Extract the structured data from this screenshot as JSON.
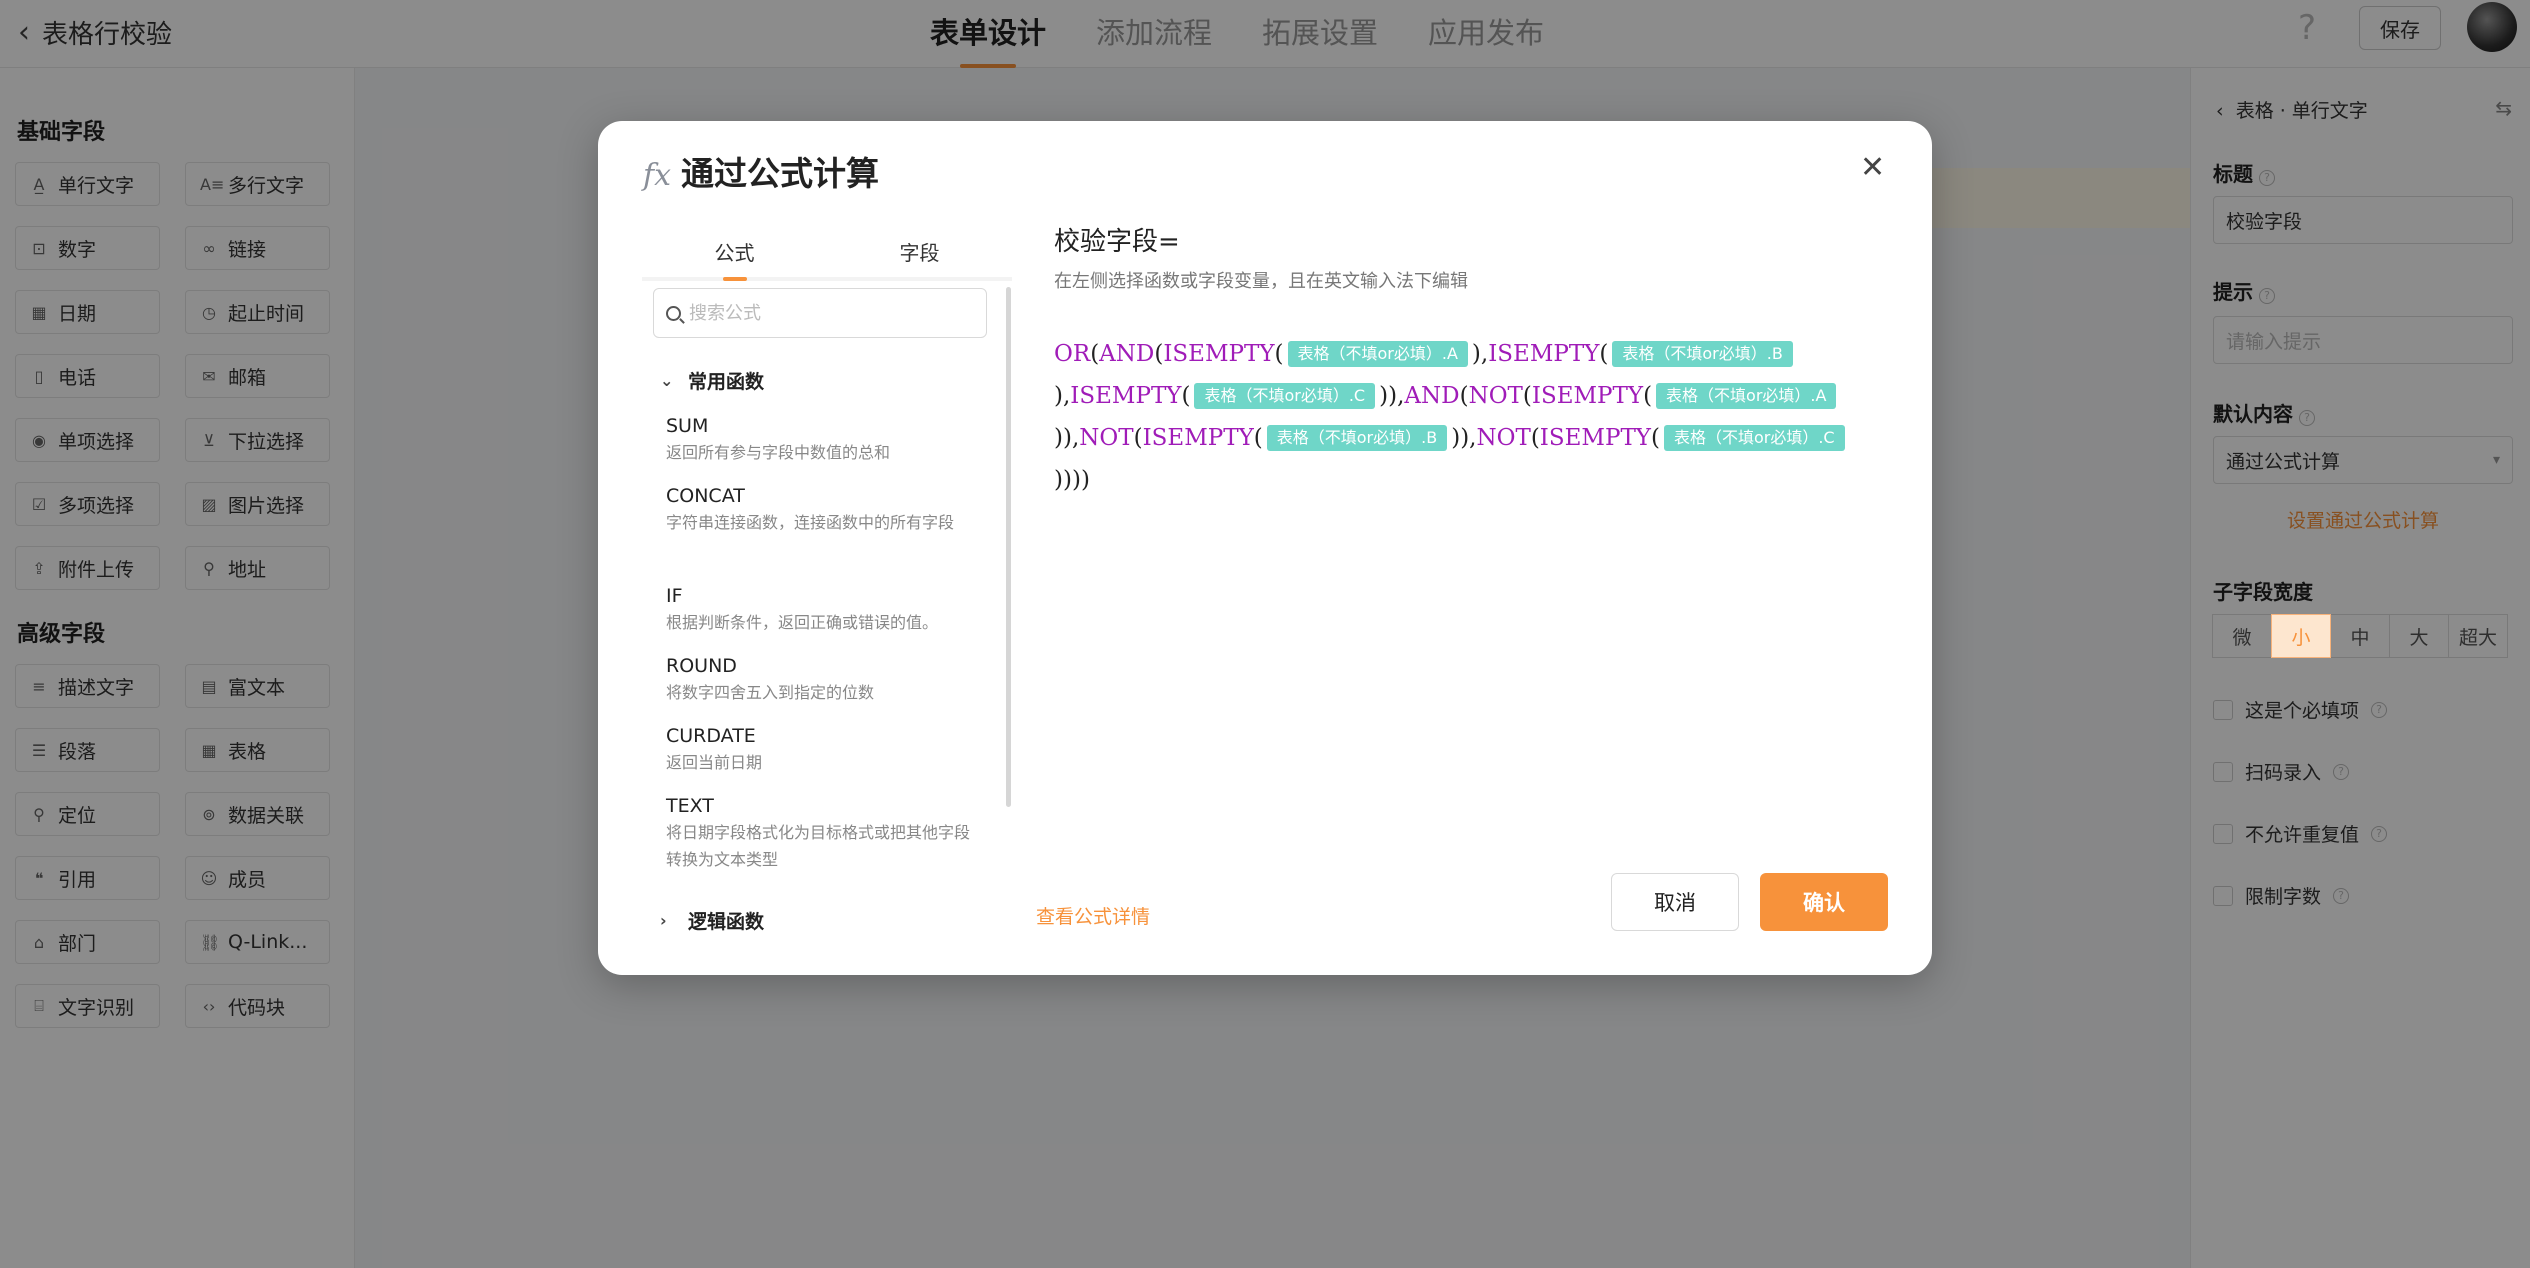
{
  "header": {
    "back_label": "表格行校验",
    "tabs": [
      {
        "label": "表单设计",
        "active": true
      },
      {
        "label": "添加流程",
        "active": false
      },
      {
        "label": "拓展设置",
        "active": false
      },
      {
        "label": "应用发布",
        "active": false
      }
    ],
    "help_glyph": "?",
    "save_label": "保存"
  },
  "left_panel": {
    "basic_title": "基础字段",
    "basic_fields": [
      {
        "label": "单行文字",
        "icon": "A̲"
      },
      {
        "label": "多行文字",
        "icon": "A≡"
      },
      {
        "label": "数字",
        "icon": "⊡"
      },
      {
        "label": "链接",
        "icon": "∞"
      },
      {
        "label": "日期",
        "icon": "▦"
      },
      {
        "label": "起止时间",
        "icon": "◷"
      },
      {
        "label": "电话",
        "icon": "▯"
      },
      {
        "label": "邮箱",
        "icon": "✉"
      },
      {
        "label": "单项选择",
        "icon": "◉"
      },
      {
        "label": "下拉选择",
        "icon": "⊻"
      },
      {
        "label": "多项选择",
        "icon": "☑"
      },
      {
        "label": "图片选择",
        "icon": "▨"
      },
      {
        "label": "附件上传",
        "icon": "⇪"
      },
      {
        "label": "地址",
        "icon": "⚲"
      }
    ],
    "advanced_title": "高级字段",
    "advanced_fields": [
      {
        "label": "描述文字",
        "icon": "≡"
      },
      {
        "label": "富文本",
        "icon": "▤"
      },
      {
        "label": "段落",
        "icon": "☰"
      },
      {
        "label": "表格",
        "icon": "▦"
      },
      {
        "label": "定位",
        "icon": "⚲"
      },
      {
        "label": "数据关联",
        "icon": "⊚"
      },
      {
        "label": "引用",
        "icon": "❝"
      },
      {
        "label": "成员",
        "icon": "☺"
      },
      {
        "label": "部门",
        "icon": "⌂"
      },
      {
        "label": "Q-Link...",
        "icon": "⛓"
      },
      {
        "label": "文字识别",
        "icon": "⌸"
      },
      {
        "label": "代码块",
        "icon": "‹›"
      }
    ]
  },
  "right_panel": {
    "breadcrumb": "表格 · 单行文字",
    "title_label": "标题",
    "title_value": "校验字段",
    "hint_label": "提示",
    "hint_placeholder": "请输入提示",
    "default_label": "默认内容",
    "default_value": "通过公式计算",
    "set_formula_link": "设置通过公式计算",
    "width_label": "子字段宽度",
    "width_options": [
      {
        "label": "微",
        "active": false
      },
      {
        "label": "小",
        "active": true
      },
      {
        "label": "中",
        "active": false
      },
      {
        "label": "大",
        "active": false
      },
      {
        "label": "超大",
        "active": false
      }
    ],
    "checkboxes": [
      "这是个必填项",
      "扫码录入",
      "不允许重复值",
      "限制字数"
    ]
  },
  "modal": {
    "fx_glyph": "fx",
    "title": "通过公式计算",
    "close_glyph": "✕",
    "tabs": [
      {
        "label": "公式",
        "active": true
      },
      {
        "label": "字段",
        "active": false
      }
    ],
    "search_placeholder": "搜索公式",
    "category_open": "常用函数",
    "functions": [
      {
        "name": "SUM",
        "desc": "返回所有参与字段中数值的总和"
      },
      {
        "name": "CONCAT",
        "desc": "字符串连接函数，连接函数中的所有字段"
      },
      {
        "name": "IF",
        "desc": "根据判断条件，返回正确或错误的值。"
      },
      {
        "name": "ROUND",
        "desc": "将数字四舍五入到指定的位数"
      },
      {
        "name": "CURDATE",
        "desc": "返回当前日期"
      },
      {
        "name": "TEXT",
        "desc": "将日期字段格式化为目标格式或把其他字段转换为文本类型"
      }
    ],
    "category_closed": "逻辑函数",
    "formula_title": "校验字段=",
    "formula_hint": "在左侧选择函数或字段变量，且在英文输入法下编辑",
    "formula_tokens": [
      {
        "t": "fn",
        "v": "OR"
      },
      {
        "t": "p",
        "v": "("
      },
      {
        "t": "fn",
        "v": "AND"
      },
      {
        "t": "p",
        "v": "("
      },
      {
        "t": "fn",
        "v": "ISEMPTY"
      },
      {
        "t": "p",
        "v": "("
      },
      {
        "t": "field",
        "v": "表格（不填or必填）.A"
      },
      {
        "t": "p",
        "v": ")"
      },
      {
        "t": "p",
        "v": ","
      },
      {
        "t": "fn",
        "v": "ISEMPTY"
      },
      {
        "t": "p",
        "v": "("
      },
      {
        "t": "field",
        "v": "表格（不填or必填）.B"
      },
      {
        "t": "p",
        "v": ")"
      },
      {
        "t": "p",
        "v": ","
      },
      {
        "t": "fn",
        "v": "ISEMPTY"
      },
      {
        "t": "p",
        "v": "("
      },
      {
        "t": "field",
        "v": "表格（不填or必填）.C"
      },
      {
        "t": "p",
        "v": ")"
      },
      {
        "t": "p",
        "v": ")"
      },
      {
        "t": "p",
        "v": ","
      },
      {
        "t": "fn",
        "v": "AND"
      },
      {
        "t": "p",
        "v": "("
      },
      {
        "t": "fn",
        "v": "NOT"
      },
      {
        "t": "p",
        "v": "("
      },
      {
        "t": "fn",
        "v": "ISEMPTY"
      },
      {
        "t": "p",
        "v": "("
      },
      {
        "t": "field",
        "v": "表格（不填or必填）.A"
      },
      {
        "t": "p",
        "v": ")"
      },
      {
        "t": "p",
        "v": ")"
      },
      {
        "t": "p",
        "v": ","
      },
      {
        "t": "fn",
        "v": "NOT"
      },
      {
        "t": "p",
        "v": "("
      },
      {
        "t": "fn",
        "v": "ISEMPTY"
      },
      {
        "t": "p",
        "v": "("
      },
      {
        "t": "field",
        "v": "表格（不填or必填）.B"
      },
      {
        "t": "p",
        "v": ")"
      },
      {
        "t": "p",
        "v": ")"
      },
      {
        "t": "p",
        "v": ","
      },
      {
        "t": "fn",
        "v": "NOT"
      },
      {
        "t": "p",
        "v": "("
      },
      {
        "t": "fn",
        "v": "ISEMPTY"
      },
      {
        "t": "p",
        "v": "("
      },
      {
        "t": "field",
        "v": "表格（不填or必填）.C"
      },
      {
        "t": "p",
        "v": ")"
      },
      {
        "t": "p",
        "v": ")"
      },
      {
        "t": "p",
        "v": ")"
      },
      {
        "t": "p",
        "v": ")"
      }
    ],
    "detail_link": "查看公式详情",
    "cancel_label": "取消",
    "confirm_label": "确认"
  },
  "colors": {
    "accent": "#f7923b",
    "function_token": "#a01cb8",
    "field_token_bg": "#6fd6c8"
  }
}
